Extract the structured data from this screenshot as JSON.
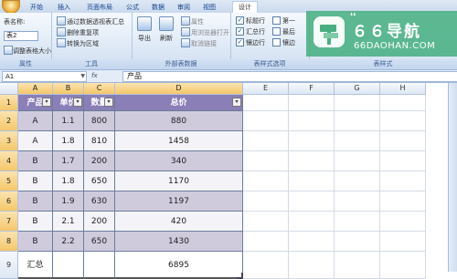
{
  "ribbon_tabs": [
    "开始",
    "插入",
    "页面布局",
    "公式",
    "数据",
    "审阅",
    "视图",
    "设计"
  ],
  "active_tab": "设计",
  "properties": {
    "table_name_label": "表名称:",
    "table_name_value": "表2",
    "resize_label": "调整表格大小",
    "group_title": "属性"
  },
  "tools": {
    "pivot_label": "通过数据透视表汇总",
    "remove_dup_label": "删除重复项",
    "convert_label": "转换为区域",
    "group_title": "工具"
  },
  "external": {
    "export_label": "导出",
    "refresh_label": "刷新",
    "properties_label": "属性",
    "open_browser_label": "用浏览器打开",
    "unlink_label": "取消链接",
    "group_title": "外部表数据"
  },
  "style_options": {
    "header_row_label": "标题行",
    "total_row_label": "汇总行",
    "banded_rows_label": "镶边行",
    "first_col_label": "第一",
    "last_col_label": "最后",
    "banded_cols_label": "镶边",
    "group_title": "表样式选项"
  },
  "styles_group_title": "表样式",
  "watermark": {
    "title": "６６导航",
    "subtitle": "66DAOHAN.COM"
  },
  "formula_bar": {
    "name_box": "A1",
    "fx": "fx",
    "content": "产品"
  },
  "columns": [
    "A",
    "B",
    "C",
    "D",
    "E",
    "F",
    "G",
    "H"
  ],
  "rows": [
    "1",
    "2",
    "3",
    "4",
    "5",
    "6",
    "7",
    "8",
    "9"
  ],
  "table": {
    "headers": [
      "产品",
      "单价",
      "数量",
      "总价"
    ],
    "data": [
      [
        "A",
        "1.1",
        "800",
        "880"
      ],
      [
        "A",
        "1.8",
        "810",
        "1458"
      ],
      [
        "B",
        "1.7",
        "200",
        "340"
      ],
      [
        "B",
        "1.8",
        "650",
        "1170"
      ],
      [
        "B",
        "1.9",
        "630",
        "1197"
      ],
      [
        "B",
        "2.1",
        "200",
        "420"
      ],
      [
        "B",
        "2.2",
        "650",
        "1430"
      ]
    ],
    "total_label": "汇总",
    "total_value": "6895"
  },
  "colors": {
    "header_fill": "#8b7fb8",
    "band_dark": "#cfcbdd",
    "band_light": "#f4f3f8",
    "watermark": "#48af82"
  }
}
